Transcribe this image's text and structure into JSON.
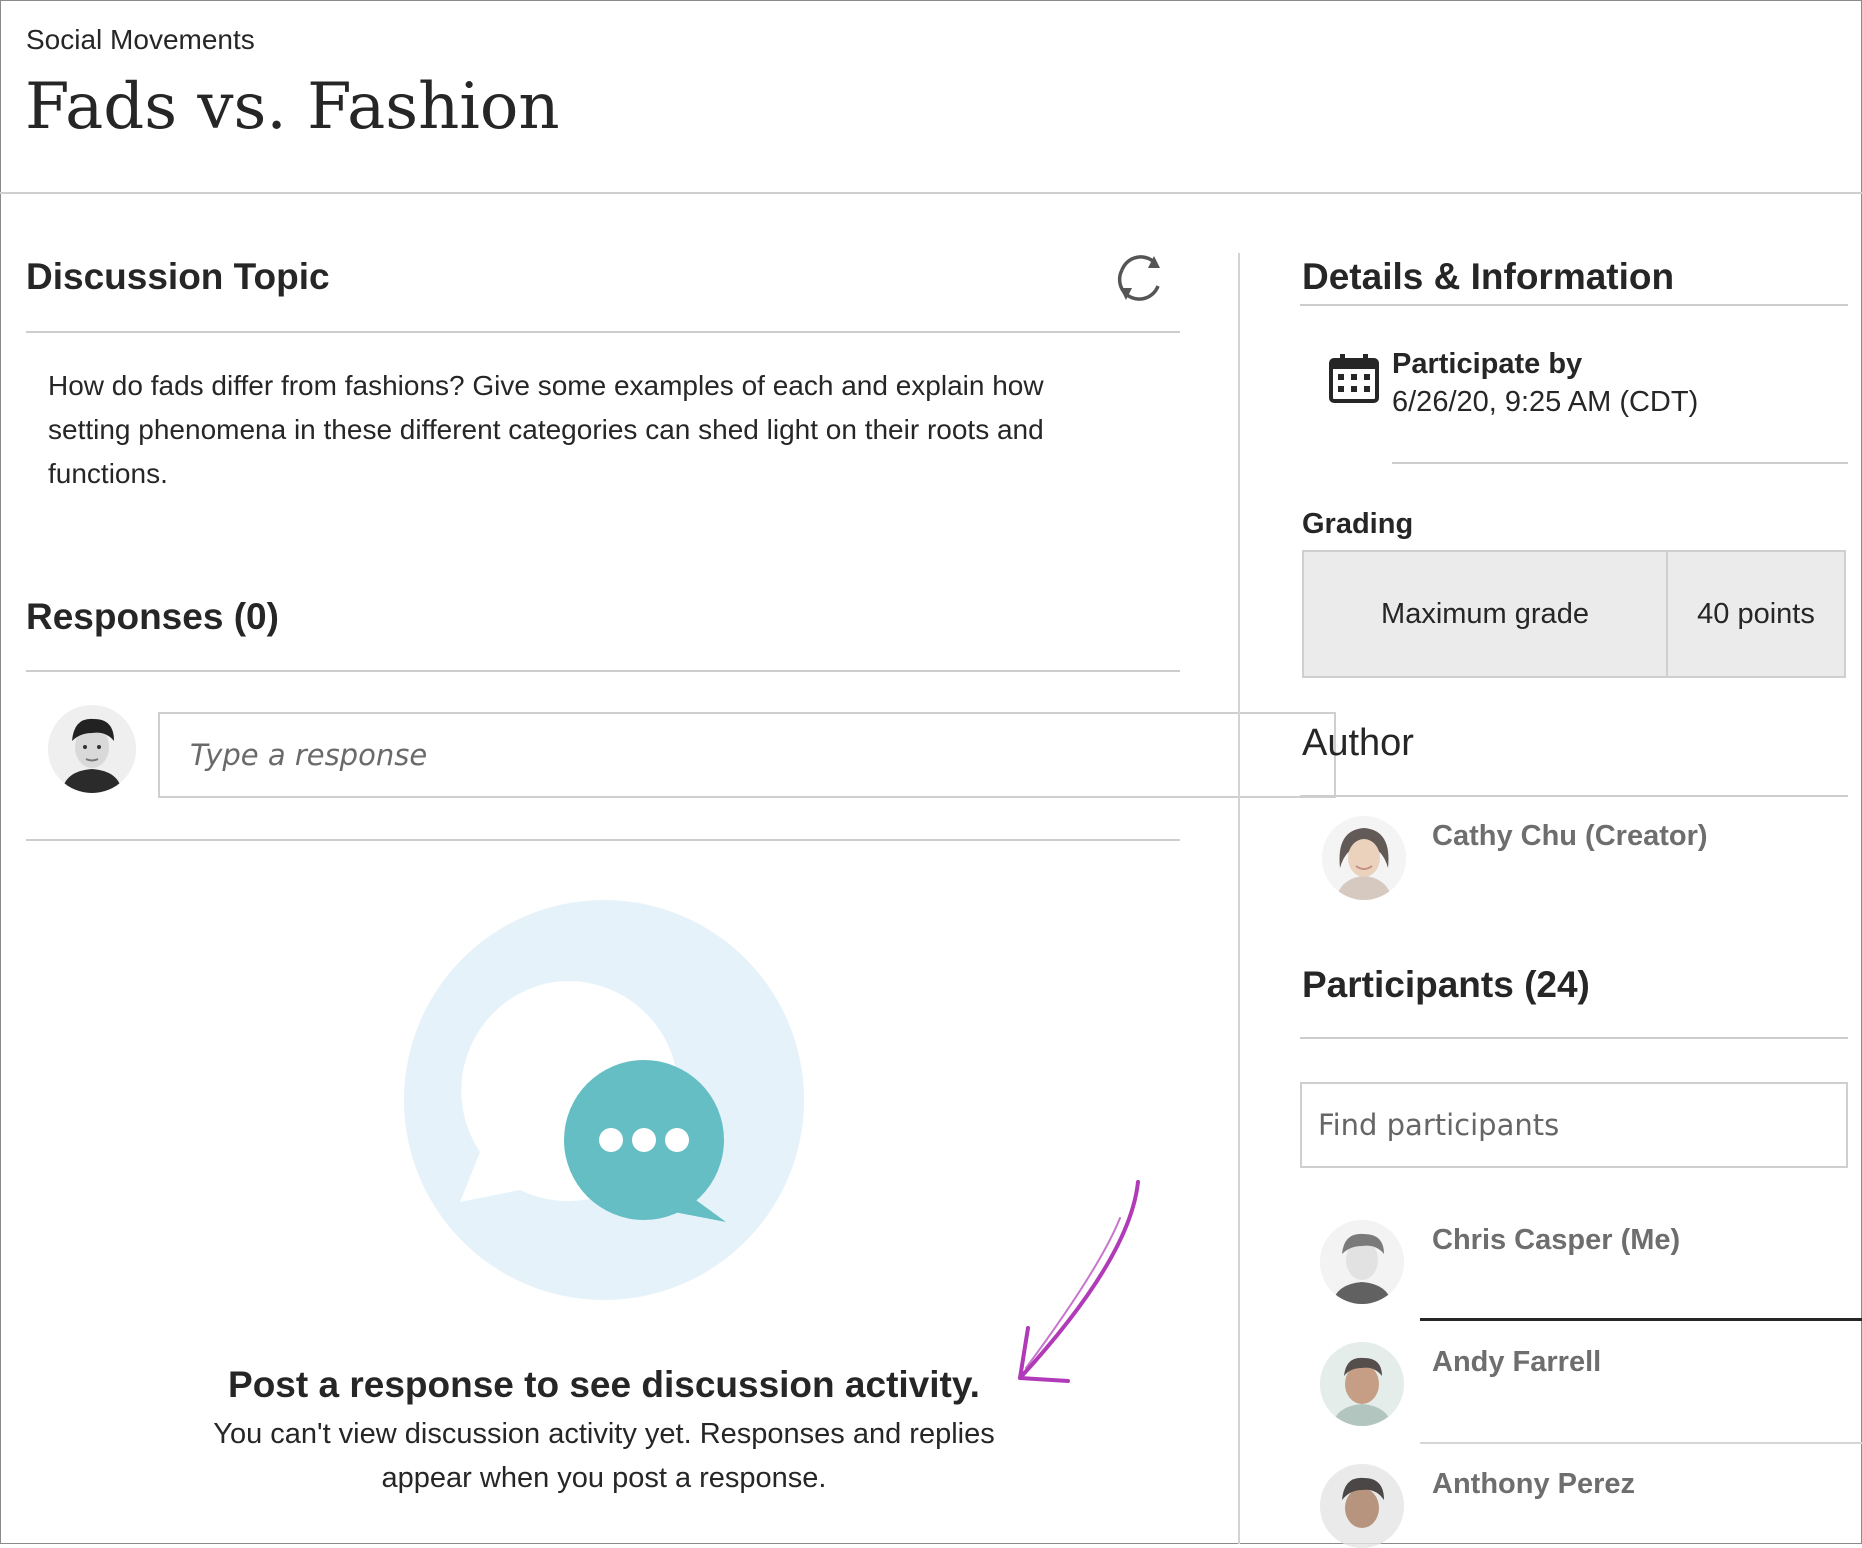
{
  "header": {
    "breadcrumb": "Social Movements",
    "title": "Fads vs. Fashion"
  },
  "topic": {
    "heading": "Discussion Topic",
    "refresh_icon": "refresh-icon",
    "text": "How do fads differ from fashions? Give some examples of each and explain how setting phenomena in these different categories can shed light on their roots and functions."
  },
  "responses": {
    "heading": "Responses (0)",
    "input_placeholder": "Type a response",
    "empty_title": "Post a response to see discussion activity.",
    "empty_desc": "You can't view discussion activity yet. Responses and replies appear when you post a response."
  },
  "details": {
    "heading": "Details & Information",
    "calendar_icon": "calendar-icon",
    "participate_label": "Participate by",
    "participate_date": "6/26/20, 9:25 AM (CDT)",
    "grading_label": "Grading",
    "grade_name": "Maximum grade",
    "grade_value": "40 points"
  },
  "author": {
    "heading": "Author",
    "name": "Cathy Chu (Creator)"
  },
  "participants": {
    "heading": "Participants (24)",
    "search_placeholder": "Find participants",
    "list": [
      {
        "name": "Chris Casper (Me)"
      },
      {
        "name": "Andy Farrell"
      },
      {
        "name": "Anthony Perez"
      }
    ]
  },
  "colors": {
    "illustration_circle": "#e5f2fa",
    "chat_bubble": "#64bec4",
    "annotation_arrow": "#b03ab8"
  }
}
